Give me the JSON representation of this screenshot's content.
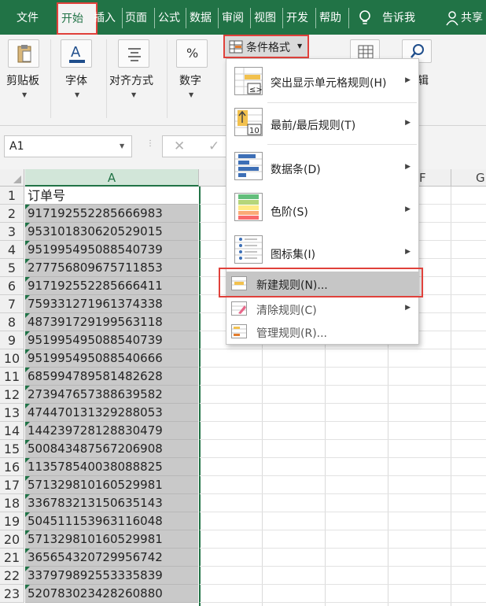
{
  "ribbon_tabs": [
    "文件",
    "开始",
    "插入",
    "页面",
    "公式",
    "数据",
    "审阅",
    "视图",
    "开发",
    "帮助",
    "告诉我",
    "共享"
  ],
  "ribbon_groups": {
    "clipboard": "剪贴板",
    "font": "字体",
    "alignment": "对齐方式",
    "number": "数字",
    "number_symbol": "%",
    "conditional_format": "条件格式",
    "edit_partial": "辑"
  },
  "name_box": "A1",
  "column_headers": [
    "A",
    "F",
    "G"
  ],
  "rows": [
    {
      "n": "1",
      "v": "订单号"
    },
    {
      "n": "2",
      "v": "917192552285666983"
    },
    {
      "n": "3",
      "v": "953101830620529015"
    },
    {
      "n": "4",
      "v": "951995495088540739"
    },
    {
      "n": "5",
      "v": "277756809675711853"
    },
    {
      "n": "6",
      "v": "917192552285666411"
    },
    {
      "n": "7",
      "v": "759331271961374338"
    },
    {
      "n": "8",
      "v": "487391729199563118"
    },
    {
      "n": "9",
      "v": "951995495088540739"
    },
    {
      "n": "10",
      "v": "951995495088540666"
    },
    {
      "n": "11",
      "v": "685994789581482628"
    },
    {
      "n": "12",
      "v": "273947657388639582"
    },
    {
      "n": "13",
      "v": "474470131329288053"
    },
    {
      "n": "14",
      "v": "144239728128830479"
    },
    {
      "n": "15",
      "v": "500843487567206908"
    },
    {
      "n": "16",
      "v": "113578540038088825"
    },
    {
      "n": "17",
      "v": "571329810160529981"
    },
    {
      "n": "18",
      "v": "336783213150635143"
    },
    {
      "n": "19",
      "v": "504511153963116048"
    },
    {
      "n": "20",
      "v": "571329810160529981"
    },
    {
      "n": "21",
      "v": "365654320729956742"
    },
    {
      "n": "22",
      "v": "337979892553335839"
    },
    {
      "n": "23",
      "v": "520783023428260880"
    }
  ],
  "menu": {
    "highlight_rules": "突出显示单元格规则(H)",
    "top_bottom_rules": "最前/最后规则(T)",
    "data_bars": "数据条(D)",
    "color_scales": "色阶(S)",
    "icon_sets": "图标集(I)",
    "new_rule": "新建规则(N)...",
    "clear_rules": "清除规则(C)",
    "manage_rules": "管理规则(R)...",
    "top_bottom_icon_number": "10"
  },
  "colors": {
    "accent": "#217346",
    "highlight_border": "#e0413b",
    "selection": "#c9c9c9"
  }
}
